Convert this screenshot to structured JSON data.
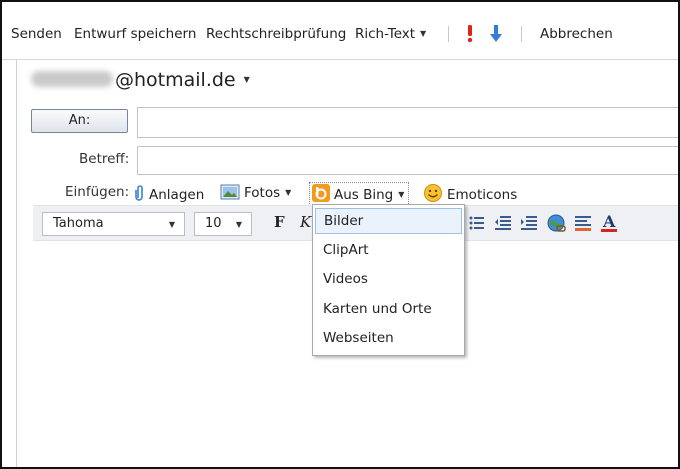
{
  "toolbar": {
    "send": "Senden",
    "save_draft": "Entwurf speichern",
    "spellcheck": "Rechtschreibprüfung",
    "rich_text": "Rich-Text",
    "cancel": "Abbrechen"
  },
  "compose": {
    "from_domain": "@hotmail.de",
    "to_button": "An:",
    "to_value": "",
    "subject_label": "Betreff:",
    "subject_value": "",
    "insert_label": "Einfügen:",
    "insert": {
      "attachments": "Anlagen",
      "photos": "Fotos",
      "bing": "Aus Bing",
      "emoticons": "Emoticons"
    }
  },
  "format": {
    "font_family": "Tahoma",
    "font_size": "10",
    "bold_label": "F",
    "italic_label": "K"
  },
  "bing_menu": {
    "items": [
      "Bilder",
      "ClipArt",
      "Videos",
      "Karten und Orte",
      "Webseiten"
    ],
    "highlighted": "Bilder"
  },
  "icons": {
    "importance_high": "red-exclamation-icon",
    "importance_low": "blue-down-arrow-icon",
    "attachment": "paperclip-icon",
    "photos": "photo-icon",
    "bing": "bing-icon",
    "emoticons": "smiley-icon",
    "font_color": "font-color-icon"
  },
  "colors": {
    "importance_high": "#d9261c",
    "importance_low": "#2f7fd6",
    "bing_orange": "#f39a1e",
    "font_color_underline": "#d9261c",
    "menu_highlight": "#eaf2fb"
  }
}
